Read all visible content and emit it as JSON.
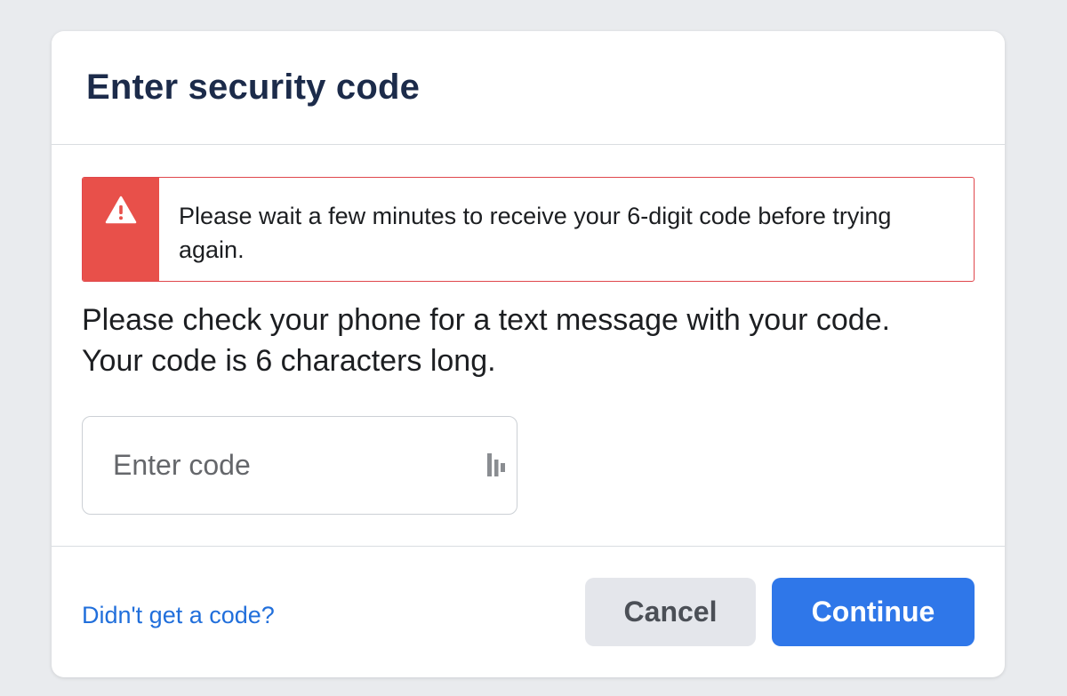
{
  "dialog": {
    "title": "Enter security code"
  },
  "alert": {
    "icon": "warning-icon",
    "message": "Please wait a few minutes to receive your 6-digit code before trying again.",
    "color": "#e8504a"
  },
  "instructions": {
    "line1": "Please check your phone for a text message with your code.",
    "line2": "Your code is 6 characters long."
  },
  "code_input": {
    "placeholder": "Enter code",
    "value": "",
    "extension_icon": "password-manager-icon"
  },
  "footer": {
    "help_link": "Didn't get a code?",
    "cancel_label": "Cancel",
    "continue_label": "Continue",
    "accent_color": "#2f77e9"
  }
}
